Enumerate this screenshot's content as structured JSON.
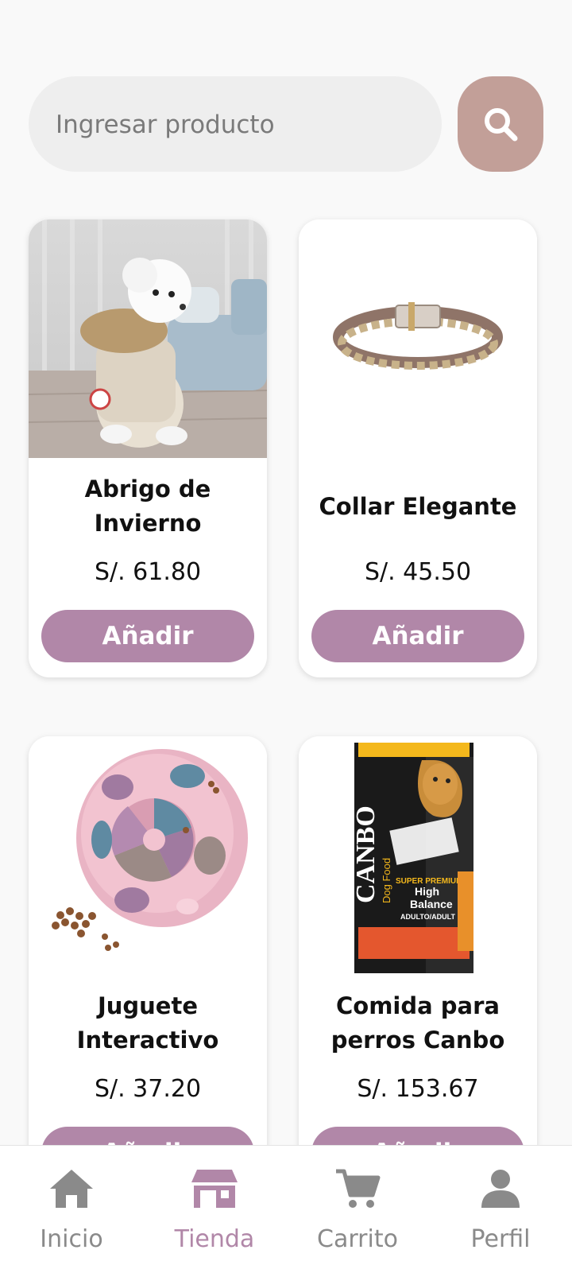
{
  "search": {
    "placeholder": "Ingresar producto"
  },
  "products": [
    {
      "name": "Abrigo de Invierno",
      "price": "S/. 61.80",
      "button": "Añadir"
    },
    {
      "name": "Collar Elegante",
      "price": "S/. 45.50",
      "button": "Añadir"
    },
    {
      "name": "Juguete Interactivo",
      "price": "S/. 37.20",
      "button": "Añadir"
    },
    {
      "name": "Comida para perros Canbo",
      "price": "S/. 153.67",
      "button": "Añadir"
    }
  ],
  "dog_food_bag": {
    "brand": "CANBO",
    "sub": "Dog Food",
    "line1": "SUPER PREMIUM",
    "line2": "High",
    "line3": "Balance",
    "line4": "ADULTO/ADULT"
  },
  "nav": [
    {
      "label": "Inicio",
      "icon": "home-icon"
    },
    {
      "label": "Tienda",
      "icon": "store-icon",
      "active": true
    },
    {
      "label": "Carrito",
      "icon": "cart-icon"
    },
    {
      "label": "Perfil",
      "icon": "profile-icon"
    }
  ],
  "colors": {
    "search_button": "#c29f98",
    "add_button": "#b187a8",
    "nav_active": "#b187a8",
    "nav_inactive": "#8a8a8a"
  }
}
